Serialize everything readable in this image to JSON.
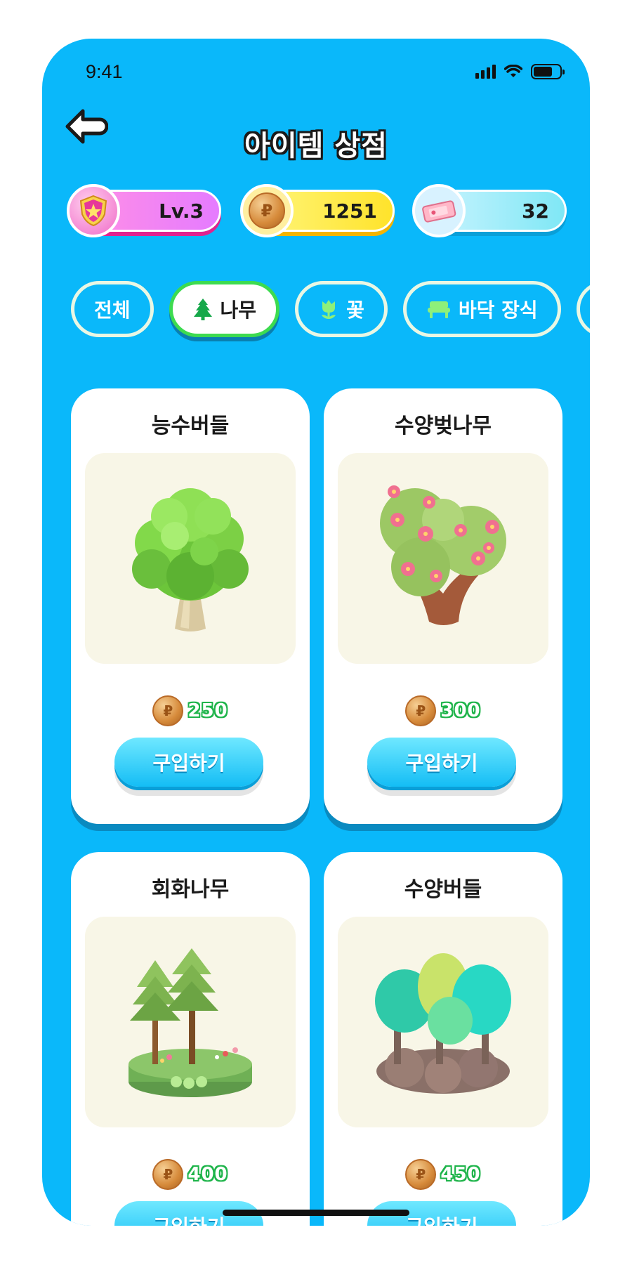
{
  "status_bar": {
    "time": "9:41"
  },
  "header": {
    "title": "아이템 상점"
  },
  "stats": {
    "level": "Lv.3",
    "coins": "1251",
    "tickets": "32"
  },
  "tabs": [
    {
      "label": "전체",
      "icon": "",
      "active": false
    },
    {
      "label": "나무",
      "icon": "tree-icon",
      "active": true
    },
    {
      "label": "꽃",
      "icon": "flower-icon",
      "active": false
    },
    {
      "label": "바닥 장식",
      "icon": "bench-icon",
      "active": false
    }
  ],
  "items": [
    {
      "name": "능수버들",
      "price": "250",
      "buy_label": "구입하기",
      "image": "round-green-tree"
    },
    {
      "name": "수양벚나무",
      "price": "300",
      "buy_label": "구입하기",
      "image": "blossom-tree"
    },
    {
      "name": "회화나무",
      "price": "400",
      "buy_label": "구입하기",
      "image": "pine-island"
    },
    {
      "name": "수양버들",
      "price": "450",
      "buy_label": "구입하기",
      "image": "teal-grove"
    }
  ],
  "colors": {
    "background": "#0AB8FA",
    "card": "#FFFFFF",
    "image_bg": "#F8F6E7",
    "active_tab_border": "#3DDB50",
    "price_outline": "#1EB44A",
    "buy_button": "#14BDF5"
  }
}
